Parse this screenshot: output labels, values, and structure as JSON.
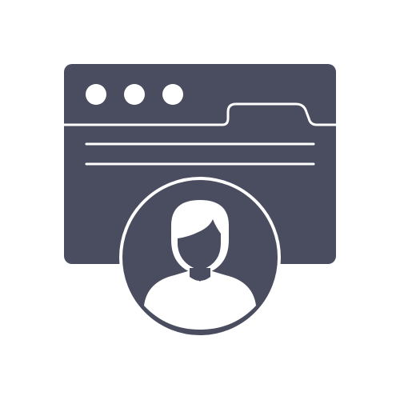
{
  "icon": {
    "name": "browser-window-user-profile-icon",
    "colors": {
      "primary": "#4a4d60",
      "background": "#ffffff",
      "stroke": "#ffffff"
    },
    "window_dots": 3,
    "content_lines": 2
  }
}
